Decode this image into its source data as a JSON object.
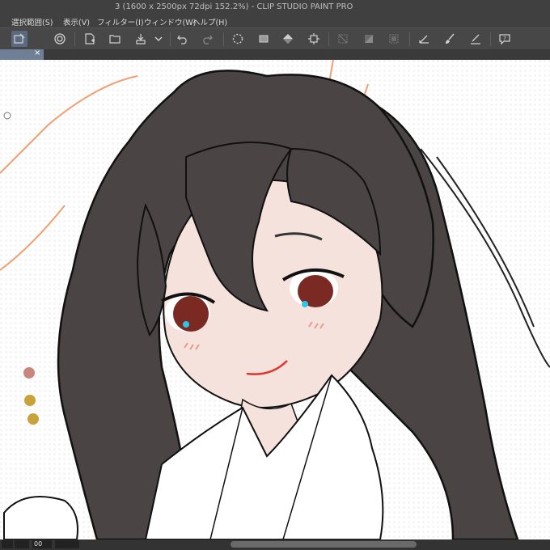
{
  "window": {
    "title": "3 (1600 x 2500px 72dpi 152.2%) - CLIP STUDIO PAINT PRO"
  },
  "menu": {
    "items": [
      {
        "label": "選択範囲(S)"
      },
      {
        "label": "表示(V)"
      },
      {
        "label": "フィルター(I)"
      },
      {
        "label": "ウィンドウ(W)"
      },
      {
        "label": "ヘルプ(H)"
      }
    ]
  },
  "toolbar": {
    "icons": [
      "layer-select-icon",
      "reference-icon",
      "new-file-icon",
      "open-file-icon",
      "save-icon",
      "dropdown-chevron-icon",
      "undo-icon",
      "redo-icon",
      "loading-icon",
      "transform-icon",
      "fill-icon",
      "crop-icon",
      "clear-selection-icon",
      "invert-selection-icon",
      "selection-border-icon",
      "pen-tool-icon",
      "brush-tool-icon",
      "draw-tool-icon",
      "help-icon"
    ]
  },
  "tab": {
    "close_label": "×"
  },
  "status": {
    "zoom_value": "00"
  },
  "colors": {
    "hair": "#4a4444",
    "skin": "#f5e2dc",
    "eye": "#7a2a22",
    "eye_highlight": "#2bc6e8",
    "lips": "#e0342d",
    "blush": "#e79a8e",
    "sketch_line": "#f0a070",
    "swatch_pink": "#c9867a",
    "swatch_gold": "#c8a23a",
    "ui_dark": "#404040"
  }
}
